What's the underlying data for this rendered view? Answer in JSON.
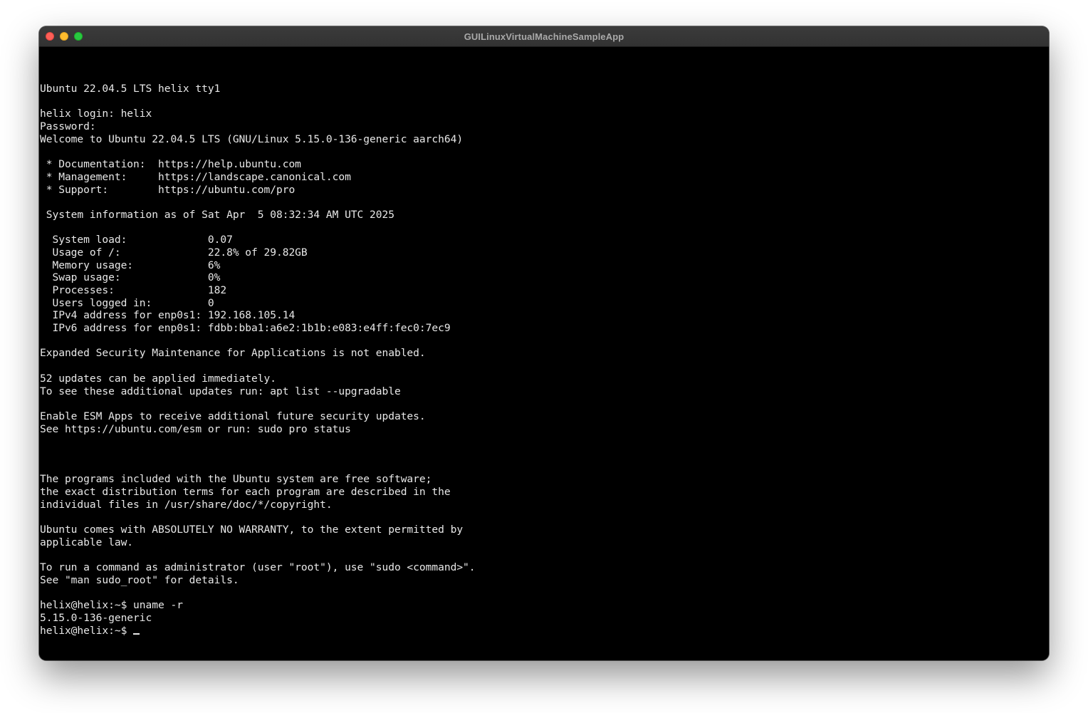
{
  "window": {
    "title": "GUILinuxVirtualMachineSampleApp"
  },
  "terminal": {
    "lines": [
      "Ubuntu 22.04.5 LTS helix tty1",
      "",
      "helix login: helix",
      "Password:",
      "Welcome to Ubuntu 22.04.5 LTS (GNU/Linux 5.15.0-136-generic aarch64)",
      "",
      " * Documentation:  https://help.ubuntu.com",
      " * Management:     https://landscape.canonical.com",
      " * Support:        https://ubuntu.com/pro",
      "",
      " System information as of Sat Apr  5 08:32:34 AM UTC 2025",
      "",
      "  System load:             0.07",
      "  Usage of /:              22.8% of 29.82GB",
      "  Memory usage:            6%",
      "  Swap usage:              0%",
      "  Processes:               182",
      "  Users logged in:         0",
      "  IPv4 address for enp0s1: 192.168.105.14",
      "  IPv6 address for enp0s1: fdbb:bba1:a6e2:1b1b:e083:e4ff:fec0:7ec9",
      "",
      "Expanded Security Maintenance for Applications is not enabled.",
      "",
      "52 updates can be applied immediately.",
      "To see these additional updates run: apt list --upgradable",
      "",
      "Enable ESM Apps to receive additional future security updates.",
      "See https://ubuntu.com/esm or run: sudo pro status",
      "",
      "",
      "",
      "The programs included with the Ubuntu system are free software;",
      "the exact distribution terms for each program are described in the",
      "individual files in /usr/share/doc/*/copyright.",
      "",
      "Ubuntu comes with ABSOLUTELY NO WARRANTY, to the extent permitted by",
      "applicable law.",
      "",
      "To run a command as administrator (user \"root\"), use \"sudo <command>\".",
      "See \"man sudo_root\" for details.",
      "",
      "helix@helix:~$ uname -r",
      "5.15.0-136-generic"
    ],
    "prompt": "helix@helix:~$ "
  }
}
